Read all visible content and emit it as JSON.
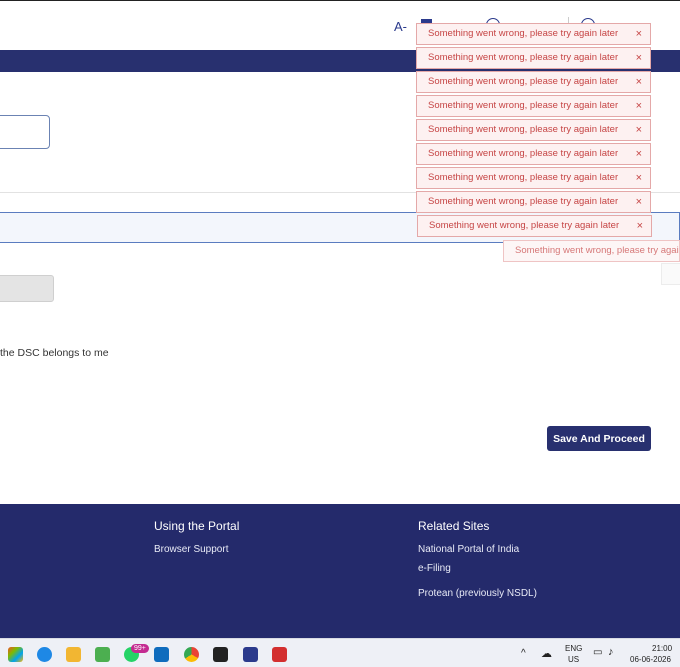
{
  "topbar": {
    "font_size_label": "A-"
  },
  "form": {
    "dsc_text": "the DSC belongs to me",
    "save_label": "Save And Proceed"
  },
  "footer": {
    "using_portal_title": "Using the Portal",
    "using_portal_links": [
      "Browser Support"
    ],
    "related_sites_title": "Related Sites",
    "related_sites_links": [
      "National Portal of India",
      "e-Filing",
      "Protean (previously NSDL)"
    ]
  },
  "toasts": {
    "message": "Something went wrong, please try again later",
    "close_glyph": "×",
    "count_stacked": 9,
    "count_faded": 1
  },
  "taskbar": {
    "whatsapp_badge": "99+",
    "lang_top": "ENG",
    "lang_bottom": "US",
    "time": "21:00",
    "date": "06-06-2026"
  },
  "colors": {
    "brand_navy": "#28306f",
    "footer_navy": "#242a6b",
    "toast_text": "#c64545",
    "toast_border": "#e4a8a8"
  }
}
